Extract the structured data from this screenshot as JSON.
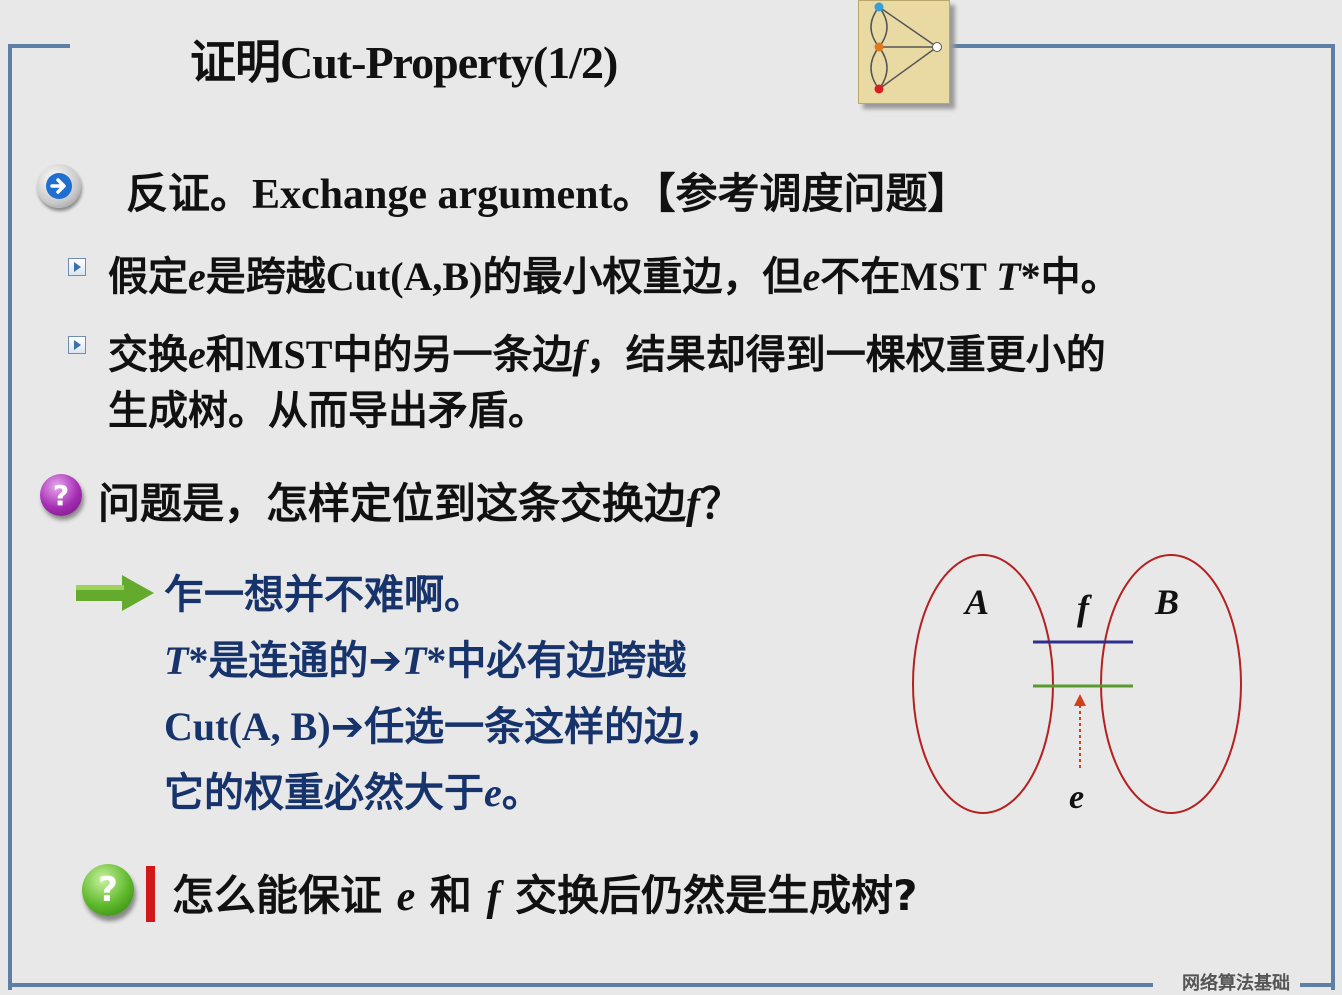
{
  "slide": {
    "title_cn": "证明",
    "title_en": "Cut-Property(1/2)",
    "bullet_main": {
      "pre": "反证。",
      "en": "Exchange argument",
      "post": "。【参考调度问题】"
    },
    "sub1": {
      "a": "假定",
      "e1": "e",
      "b": "是跨越",
      "cut": "Cut(A,B)",
      "c": "的最小权重边，但",
      "e2": "e",
      "d": "不在",
      "mst": "MST ",
      "t": "T",
      "star": "*",
      "end": "中。"
    },
    "sub2": {
      "a": "交换",
      "e": "e",
      "b": "和",
      "mst": "MST",
      "c": "中的另一条边",
      "f": "f",
      "d": "，结果却得到一棵权重更小的",
      "line2": "生成树。从而导出矛盾。"
    },
    "question1": {
      "text": "问题是，怎样定位到这条交换边",
      "f": "f",
      "q": "？"
    },
    "answer": {
      "line1": "乍一想并不难啊。",
      "l2_t1": "T",
      "l2_star1": "*",
      "l2_a": "是连通的",
      "arrow": "➔",
      "l2_t2": "T",
      "l2_star2": "*",
      "l2_b": "中必有边跨越",
      "l3_cut": "Cut(A, B)",
      "l3_arrow": "➔",
      "l3_b": "任选一条这样的边，",
      "l4_a": "它的权重必然大于",
      "l4_e": "e",
      "l4_b": "。"
    },
    "diagram": {
      "label_a": "A",
      "label_b": "B",
      "label_f": "f",
      "label_e": "e"
    },
    "question2": {
      "a": "怎么能保证 ",
      "e": "e",
      "b": " 和 ",
      "f": "f",
      "c": " 交换后仍然是生成树?"
    },
    "footer": "网络算法基础",
    "colors": {
      "frame": "#5c7fa6",
      "answer_text": "#17336b",
      "ellipse": "#b52020",
      "edge_f": "#2e2f8c",
      "edge_e": "#5a9a2e"
    },
    "icons": [
      "next-arrow-icon",
      "triangle-bullet-icon",
      "question-purple-icon",
      "right-arrow-icon",
      "question-green-icon",
      "graph-logo-icon"
    ]
  }
}
